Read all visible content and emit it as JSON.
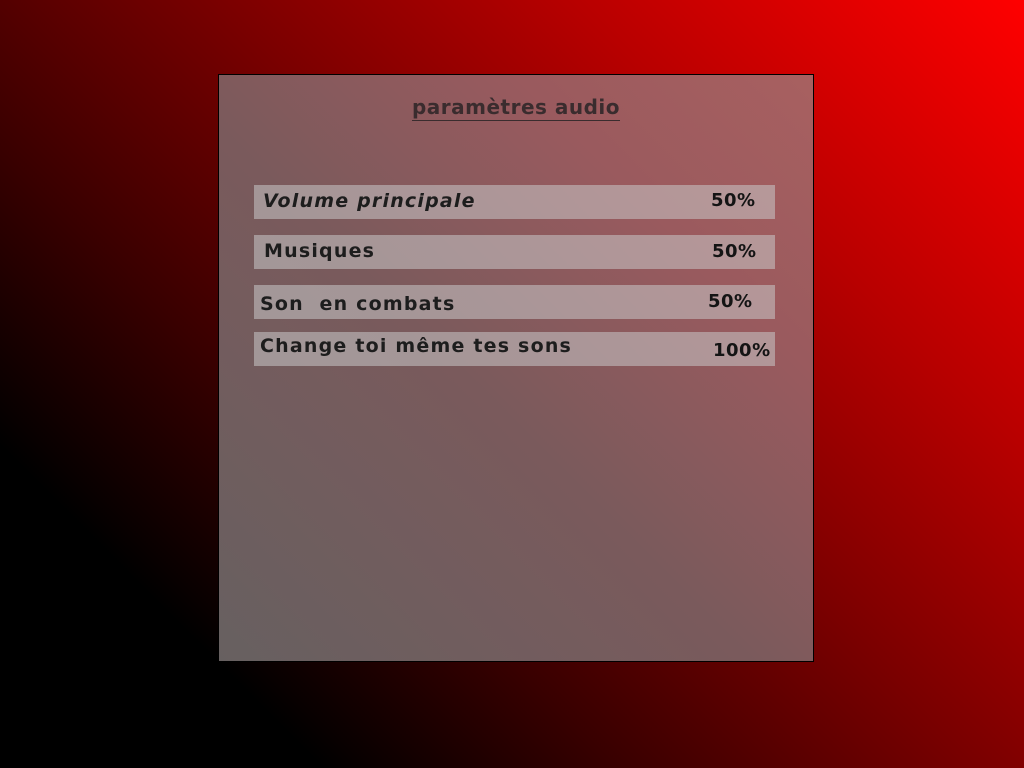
{
  "screen": {
    "title": "paramètres audio"
  },
  "settings": [
    {
      "label": "Volume principale",
      "value": "50%",
      "level": 0.5
    },
    {
      "label": "Musiques",
      "value": "50%",
      "level": 0.5
    },
    {
      "label": "Son  en combats",
      "value": "50%",
      "level": 0.5
    },
    {
      "label": "Change toi même tes sons",
      "value": "100%",
      "level": 1.0
    }
  ],
  "colors": {
    "background_dark": "#000000",
    "background_bright": "#ff0000",
    "panel": "#8a5e60",
    "row": "#a8a0a0",
    "text": "#1d1d1d"
  }
}
